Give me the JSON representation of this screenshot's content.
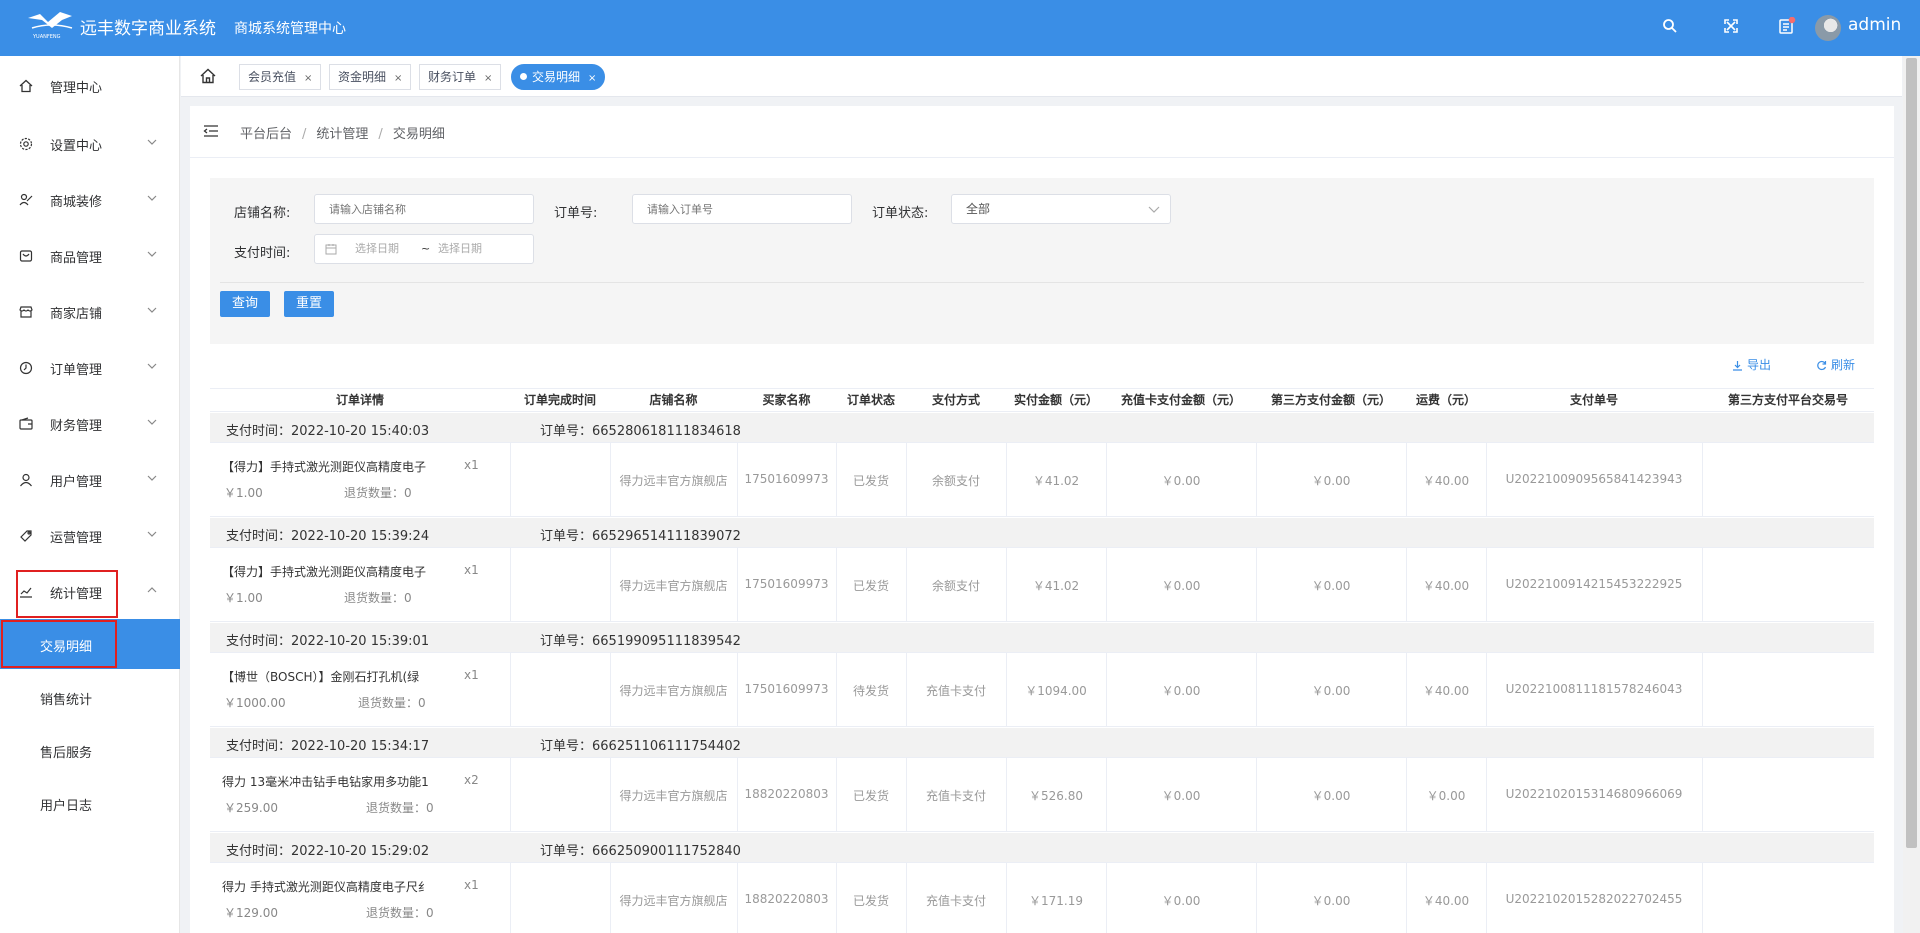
{
  "header": {
    "app_name": "远丰数字商业系统",
    "sub_name": "商城系统管理中心",
    "logo_text": "YUANFENG",
    "user_name": "admin",
    "icons": [
      "search-icon",
      "fullscreen-icon",
      "message-icon"
    ]
  },
  "sidebar": {
    "items": [
      {
        "label": "管理中心",
        "icon": "home-icon",
        "arrow": false
      },
      {
        "label": "设置中心",
        "icon": "gear-icon",
        "arrow": true
      },
      {
        "label": "商城装修",
        "icon": "decorate-icon",
        "arrow": true
      },
      {
        "label": "商品管理",
        "icon": "goods-icon",
        "arrow": true
      },
      {
        "label": "商家店铺",
        "icon": "shop-icon",
        "arrow": true
      },
      {
        "label": "订单管理",
        "icon": "order-icon",
        "arrow": true
      },
      {
        "label": "财务管理",
        "icon": "finance-icon",
        "arrow": true
      },
      {
        "label": "用户管理",
        "icon": "user-icon",
        "arrow": true
      },
      {
        "label": "运营管理",
        "icon": "operation-icon",
        "arrow": true
      },
      {
        "label": "统计管理",
        "icon": "chart-icon",
        "arrow": true
      }
    ],
    "sub_items": [
      "交易明细",
      "销售统计",
      "售后服务",
      "用户日志"
    ],
    "active_sub": "交易明细"
  },
  "tabs": [
    {
      "label": "会员充值",
      "active": false
    },
    {
      "label": "资金明细",
      "active": false
    },
    {
      "label": "财务订单",
      "active": false
    },
    {
      "label": "交易明细",
      "active": true
    }
  ],
  "breadcrumb": [
    "平台后台",
    "统计管理",
    "交易明细"
  ],
  "filter": {
    "store_label": "店铺名称:",
    "store_placeholder": "请输入店铺名称",
    "order_label": "订单号:",
    "order_placeholder": "请输入订单号",
    "status_label": "订单状态:",
    "status_value": "全部",
    "pay_time_label": "支付时间:",
    "date_start_placeholder": "选择日期",
    "date_sep": "~",
    "date_end_placeholder": "选择日期",
    "query_button": "查询",
    "reset_button": "重置"
  },
  "actions": {
    "export": "导出",
    "refresh": "刷新"
  },
  "table": {
    "headers": [
      "订单详情",
      "订单完成时间",
      "店铺名称",
      "买家名称",
      "订单状态",
      "支付方式",
      "实付金额（元）",
      "充值卡支付金额（元）",
      "第三方支付金额（元）",
      "运费（元）",
      "支付单号",
      "第三方支付平台交易号"
    ],
    "pay_time_prefix": "支付时间：",
    "order_no_prefix": "订单号：",
    "return_prefix": "退货数量：",
    "groups": [
      {
        "pay_time": "2022-10-20 15:40:03",
        "order_no": "665280618111834618",
        "product": "【得力】手持式激光测距仪高精度电子",
        "qty": "x1",
        "price": "￥1.00",
        "return_qty": "0",
        "finish_time": "",
        "store": "得力远丰官方旗舰店",
        "buyer": "17501609973",
        "status": "已发货",
        "pay_method": "余额支付",
        "paid": "￥41.02",
        "card_paid": "￥0.00",
        "third_paid": "￥0.00",
        "freight": "￥40.00",
        "pay_no": "U2022100909565841423943",
        "third_no": ""
      },
      {
        "pay_time": "2022-10-20 15:39:24",
        "order_no": "665296514111839072",
        "product": "【得力】手持式激光测距仪高精度电子",
        "qty": "x1",
        "price": "￥1.00",
        "return_qty": "0",
        "finish_time": "",
        "store": "得力远丰官方旗舰店",
        "buyer": "17501609973",
        "status": "已发货",
        "pay_method": "余额支付",
        "paid": "￥41.02",
        "card_paid": "￥0.00",
        "third_paid": "￥0.00",
        "freight": "￥40.00",
        "pay_no": "U2022100914215453222925",
        "third_no": ""
      },
      {
        "pay_time": "2022-10-20 15:39:01",
        "order_no": "665199095111839542",
        "product": "【博世（BOSCH）】金刚石打孔机(绿",
        "qty": "x1",
        "price": "￥1000.00",
        "return_qty": "0",
        "finish_time": "",
        "store": "得力远丰官方旗舰店",
        "buyer": "17501609973",
        "status": "待发货",
        "pay_method": "充值卡支付",
        "paid": "￥1094.00",
        "card_paid": "￥0.00",
        "third_paid": "￥0.00",
        "freight": "￥40.00",
        "pay_no": "U2022100811181578246043",
        "third_no": ""
      },
      {
        "pay_time": "2022-10-20 15:34:17",
        "order_no": "666251106111754402",
        "product": "得力 13毫米冲击钻手电钻家用多功能1",
        "qty": "x2",
        "price": "￥259.00",
        "return_qty": "0",
        "finish_time": "",
        "store": "得力远丰官方旗舰店",
        "buyer": "18820220803",
        "status": "已发货",
        "pay_method": "充值卡支付",
        "paid": "￥526.80",
        "card_paid": "￥0.00",
        "third_paid": "￥0.00",
        "freight": "￥0.00",
        "pay_no": "U2022102015314680966069",
        "third_no": ""
      },
      {
        "pay_time": "2022-10-20 15:29:02",
        "order_no": "666250900111752840",
        "product": "得力 手持式激光测距仪高精度电子尺纟",
        "qty": "x1",
        "price": "￥129.00",
        "return_qty": "0",
        "finish_time": "",
        "store": "得力远丰官方旗舰店",
        "buyer": "18820220803",
        "status": "已发货",
        "pay_method": "充值卡支付",
        "paid": "￥171.19",
        "card_paid": "￥0.00",
        "third_paid": "￥0.00",
        "freight": "￥40.00",
        "pay_no": "U2022102015282022702455",
        "third_no": ""
      }
    ]
  },
  "colors": {
    "primary": "#3a8ee6",
    "highlight_box": "#e02020",
    "group_bg": "#f2f2f2"
  }
}
